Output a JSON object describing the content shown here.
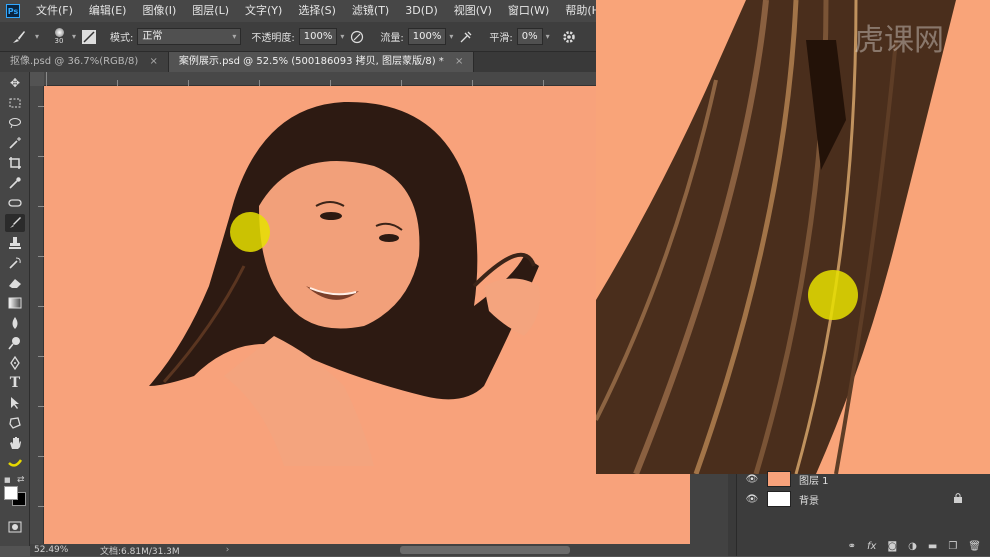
{
  "app": {
    "logo": "Ps"
  },
  "menu": [
    "文件(F)",
    "编辑(E)",
    "图像(I)",
    "图层(L)",
    "文字(Y)",
    "选择(S)",
    "滤镜(T)",
    "3D(D)",
    "视图(V)",
    "窗口(W)",
    "帮助(H)"
  ],
  "options": {
    "brush_size": "30",
    "mode_label": "模式:",
    "mode_value": "正常",
    "opacity_label": "不透明度:",
    "opacity_value": "100%",
    "flow_label": "流量:",
    "flow_value": "100%",
    "smooth_label": "平滑:",
    "smooth_value": "0%"
  },
  "tabs": [
    {
      "label": "抠像.psd @ 36.7%(RGB/8)",
      "active": false
    },
    {
      "label": "案例展示.psd @ 52.5% (500186093 拷贝, 图层蒙版/8) *",
      "active": true
    }
  ],
  "tools": [
    "move-icon",
    "marquee-icon",
    "lasso-icon",
    "magic-wand-icon",
    "crop-icon",
    "eyedropper-icon",
    "healing-icon",
    "brush-icon",
    "stamp-icon",
    "history-brush-icon",
    "eraser-icon",
    "gradient-icon",
    "blur-icon",
    "dodge-icon",
    "pen-icon",
    "type-icon",
    "path-select-icon",
    "shape-icon",
    "hand-icon",
    "zoom-icon"
  ],
  "colors": {
    "canvas": "#f8a27b",
    "highlight": "#e8e000",
    "foreground": "#ffffff",
    "background": "#000000"
  },
  "status": {
    "zoom": "52.49%",
    "doc": "文档:6.81M/31.3M"
  },
  "layers": [
    {
      "name": "图层 1",
      "thumb_color": "#f8a27b",
      "locked": false
    },
    {
      "name": "背景",
      "thumb_color": "#ffffff",
      "locked": true
    }
  ],
  "watermark": "虎课网"
}
